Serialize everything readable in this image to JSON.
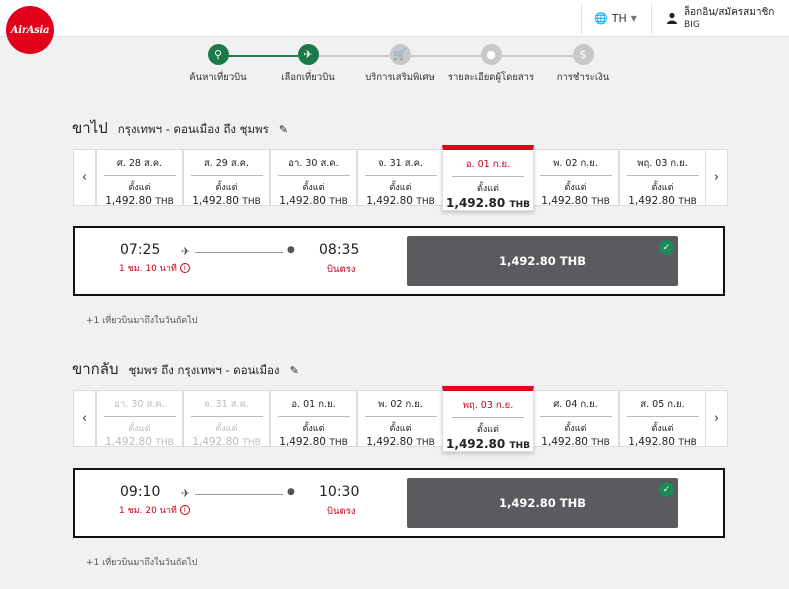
{
  "header": {
    "logo_text": "AirAsia",
    "lang": "TH",
    "login_line1": "ล็อกอิน/สมัครสมาชิก",
    "login_line2": "BIG"
  },
  "steps": [
    {
      "label": "ค้นหาเที่ยวบิน",
      "icon": "search-icon",
      "glyph": "⚲",
      "state": "done"
    },
    {
      "label": "เลือกเที่ยวบิน",
      "icon": "plane-icon",
      "glyph": "✈",
      "state": "active"
    },
    {
      "label": "บริการเสริมพิเศษ",
      "icon": "cart-icon",
      "glyph": "🛒",
      "state": "todo"
    },
    {
      "label": "รายละเอียดผู้โดยสาร",
      "icon": "person-icon",
      "glyph": "●",
      "state": "todo"
    },
    {
      "label": "การชำระเงิน",
      "icon": "dollar-icon",
      "glyph": "$",
      "state": "todo"
    }
  ],
  "colors": {
    "accent_red": "#e3001b",
    "step_green": "#1c7a4a",
    "step_grey": "#c8c8c8",
    "fare_grey": "#5a5b5e"
  },
  "outbound": {
    "title": "ขาไป",
    "route": "กรุงเทพฯ - ดอนเมือง ถึง ชุมพร",
    "from_label": "ตั้งแต่",
    "dates": [
      {
        "date": "ศ. 28 ส.ค.",
        "price": "1,492.80",
        "currency": "THB",
        "state": "normal"
      },
      {
        "date": "ส. 29 ส.ค.",
        "price": "1,492.80",
        "currency": "THB",
        "state": "normal"
      },
      {
        "date": "อา. 30 ส.ค.",
        "price": "1,492.80",
        "currency": "THB",
        "state": "normal"
      },
      {
        "date": "จ. 31 ส.ค.",
        "price": "1,492.80",
        "currency": "THB",
        "state": "normal"
      },
      {
        "date": "อ. 01 ก.ย.",
        "price": "1,492.80",
        "currency": "THB",
        "state": "selected"
      },
      {
        "date": "พ. 02 ก.ย.",
        "price": "1,492.80",
        "currency": "THB",
        "state": "normal"
      },
      {
        "date": "พฤ. 03 ก.ย.",
        "price": "1,492.80",
        "currency": "THB",
        "state": "normal"
      }
    ],
    "flight": {
      "dep": "07:25",
      "arr": "08:35",
      "duration": "1 ชม. 10 นาที",
      "direct": "บินตรง",
      "fare": "1,492.80 THB"
    },
    "note": "+1 เที่ยวบินมาถึงในวันถัดไป"
  },
  "inbound": {
    "title": "ขากลับ",
    "route": "ชุมพร ถึง กรุงเทพฯ - ดอนเมือง",
    "from_label": "ตั้งแต่",
    "dates": [
      {
        "date": "อา. 30 ส.ค.",
        "price": "1,492.80",
        "currency": "THB",
        "state": "disabled"
      },
      {
        "date": "จ. 31 ส.ค.",
        "price": "1,492.80",
        "currency": "THB",
        "state": "disabled"
      },
      {
        "date": "อ. 01 ก.ย.",
        "price": "1,492.80",
        "currency": "THB",
        "state": "normal"
      },
      {
        "date": "พ. 02 ก.ย.",
        "price": "1,492.80",
        "currency": "THB",
        "state": "normal"
      },
      {
        "date": "พฤ. 03 ก.ย.",
        "price": "1,492.80",
        "currency": "THB",
        "state": "selected"
      },
      {
        "date": "ศ. 04 ก.ย.",
        "price": "1,492.80",
        "currency": "THB",
        "state": "normal"
      },
      {
        "date": "ส. 05 ก.ย.",
        "price": "1,492.80",
        "currency": "THB",
        "state": "normal"
      }
    ],
    "flight": {
      "dep": "09:10",
      "arr": "10:30",
      "duration": "1 ชม. 20 นาที",
      "direct": "บินตรง",
      "fare": "1,492.80 THB"
    },
    "note": "+1 เที่ยวบินมาถึงในวันถัดไป"
  }
}
